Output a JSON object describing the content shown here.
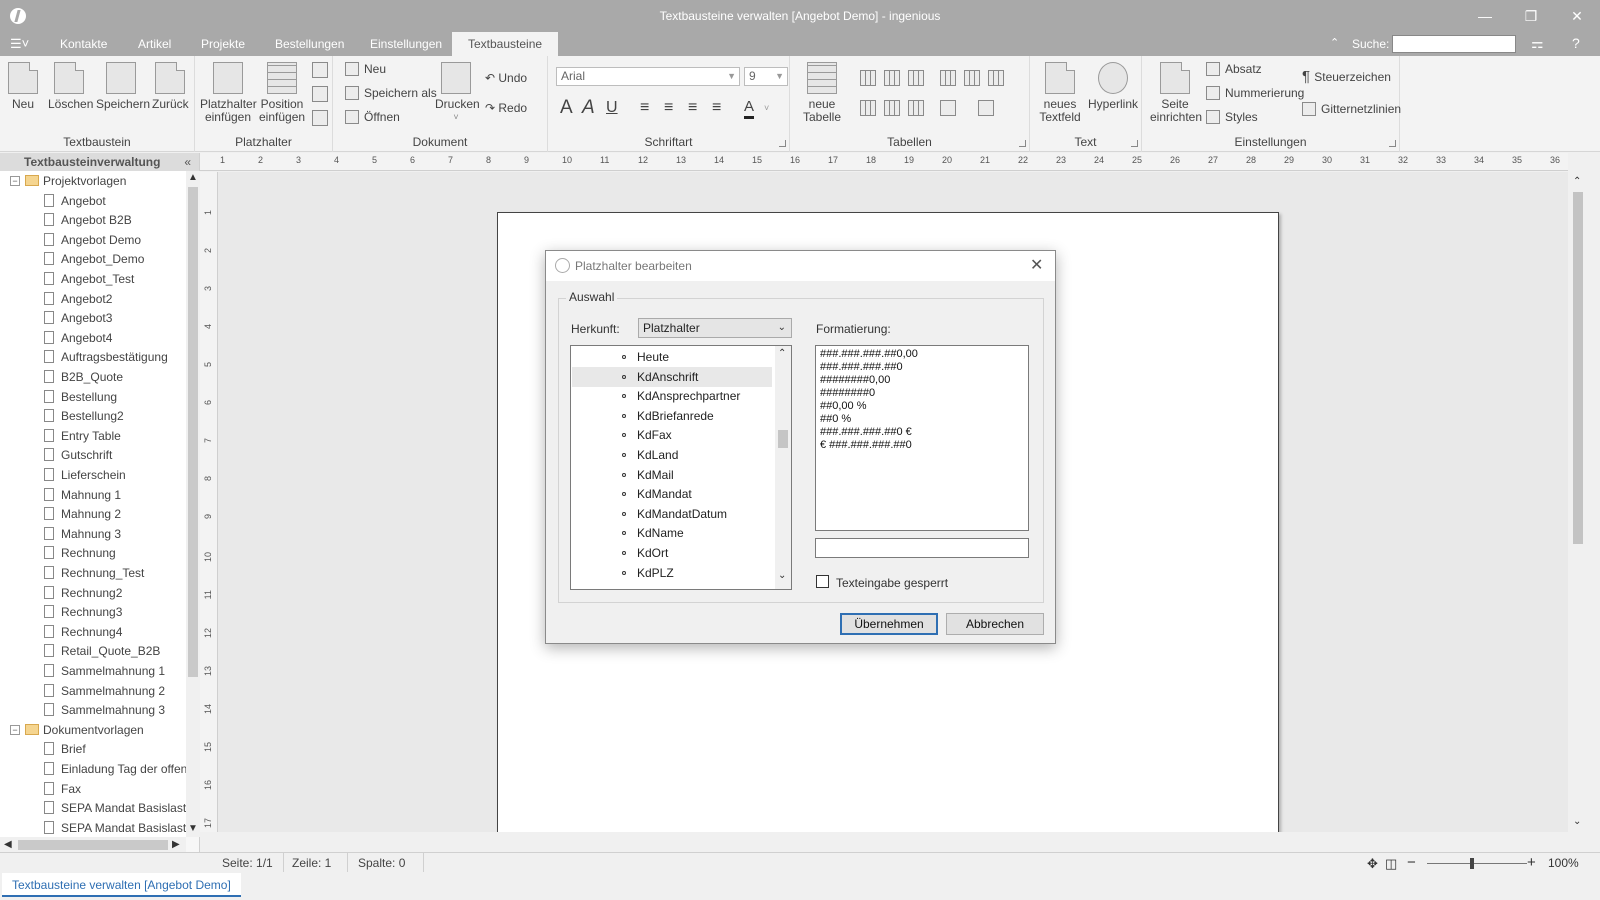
{
  "window": {
    "title": "Textbausteine verwalten [Angebot Demo] - ingenious",
    "minimize_glyph": "—",
    "restore_glyph": "❐",
    "close_glyph": "✕"
  },
  "ribbon_tabs": {
    "kontakte": "Kontakte",
    "artikel": "Artikel",
    "projekte": "Projekte",
    "bestellungen": "Bestellungen",
    "einstellungen": "Einstellungen",
    "textbausteine": "Textbausteine",
    "active": "Textbausteine"
  },
  "search": {
    "label": "Suche:",
    "value": ""
  },
  "ribbon": {
    "textbaustein": {
      "label": "Textbaustein",
      "neu": "Neu",
      "loeschen": "Löschen",
      "speichern": "Speichern",
      "zurueck": "Zurück"
    },
    "platzhalter": {
      "label": "Platzhalter",
      "einfuegen_1": "Platzhalter",
      "einfuegen_2": "einfügen",
      "position_1": "Position",
      "position_2": "einfügen"
    },
    "dokument": {
      "label": "Dokument",
      "neu": "Neu",
      "speichern_als": "Speichern als",
      "oeffnen": "Öffnen",
      "drucken": "Drucken",
      "undo": "Undo",
      "redo": "Redo"
    },
    "schriftart": {
      "label": "Schriftart",
      "font": "Arial",
      "size": "9",
      "glyph_a": "A",
      "glyph_i": "A",
      "glyph_u": "U",
      "glyph_color": "A"
    },
    "tabellen": {
      "label": "Tabellen",
      "neue_1": "neue",
      "neue_2": "Tabelle"
    },
    "text": {
      "label": "Text",
      "textfeld_1": "neues",
      "textfeld_2": "Textfeld",
      "hyperlink": "Hyperlink"
    },
    "einstellungen": {
      "label": "Einstellungen",
      "seite_1": "Seite",
      "seite_2": "einrichten",
      "absatz": "Absatz",
      "nummerierung": "Nummerierung",
      "styles": "Styles",
      "steuerzeichen": "Steuerzeichen",
      "gitternetzlinien": "Gitternetzlinien"
    }
  },
  "ruler_numbers": [
    "1",
    "2",
    "3",
    "4",
    "5",
    "6",
    "7",
    "8",
    "9",
    "10",
    "11",
    "12",
    "13",
    "14",
    "15",
    "16",
    "17",
    "18",
    "19",
    "20",
    "21",
    "22",
    "23",
    "24",
    "25",
    "26",
    "27",
    "28",
    "29",
    "30",
    "31",
    "32",
    "33",
    "34",
    "35",
    "36"
  ],
  "vruler_numbers": [
    "1",
    "2",
    "3",
    "4",
    "5",
    "6",
    "7",
    "8",
    "9",
    "10",
    "11",
    "12",
    "13",
    "14",
    "15",
    "16",
    "17"
  ],
  "sidebar": {
    "title": "Textbausteinverwaltung",
    "pin": "«",
    "folder1": "Projektvorlagen",
    "folder1_items": [
      "Angebot",
      "Angebot B2B",
      "Angebot Demo",
      "Angebot_Demo",
      "Angebot_Test",
      "Angebot2",
      "Angebot3",
      "Angebot4",
      "Auftragsbestätigung",
      "B2B_Quote",
      "Bestellung",
      "Bestellung2",
      "Entry Table",
      "Gutschrift",
      "Lieferschein",
      "Mahnung 1",
      "Mahnung 2",
      "Mahnung 3",
      "Rechnung",
      "Rechnung_Test",
      "Rechnung2",
      "Rechnung3",
      "Rechnung4",
      "Retail_Quote_B2B",
      "Sammelmahnung 1",
      "Sammelmahnung 2",
      "Sammelmahnung 3"
    ],
    "folder2": "Dokumentvorlagen",
    "folder2_items": [
      "Brief",
      "Einladung Tag der offenen",
      "Fax",
      "SEPA Mandat Basislastsch",
      "SEPA Mandat Basislastsch"
    ]
  },
  "statusbar": {
    "seite": "Seite: 1/1",
    "zeile": "Zeile: 1",
    "spalte": "Spalte: 0",
    "zoom": "100%"
  },
  "zoom_level": 0.45,
  "doc_tab": "Textbausteine verwalten [Angebot Demo]",
  "dialog": {
    "title": "Platzhalter bearbeiten",
    "group": "Auswahl",
    "herkunft_label": "Herkunft:",
    "herkunft_value": "Platzhalter",
    "formatierung_label": "Formatierung:",
    "items": [
      "Heute",
      "KdAnschrift",
      "KdAnsprechpartner",
      "KdBriefanrede",
      "KdFax",
      "KdLand",
      "KdMail",
      "KdMandat",
      "KdMandatDatum",
      "KdName",
      "KdOrt",
      "KdPLZ"
    ],
    "selected_item": "KdAnschrift",
    "formats": [
      "###.###.###.##0,00",
      "###.###.###.##0",
      "########0,00",
      "########0",
      "##0,00 %",
      "##0 %",
      "###.###.###.##0 €",
      "€ ###.###.###.##0"
    ],
    "format_input": "",
    "checkbox_label": "Texteingabe gesperrt",
    "checkbox_checked": false,
    "ok_button": "Übernehmen",
    "cancel_button": "Abbrechen"
  }
}
